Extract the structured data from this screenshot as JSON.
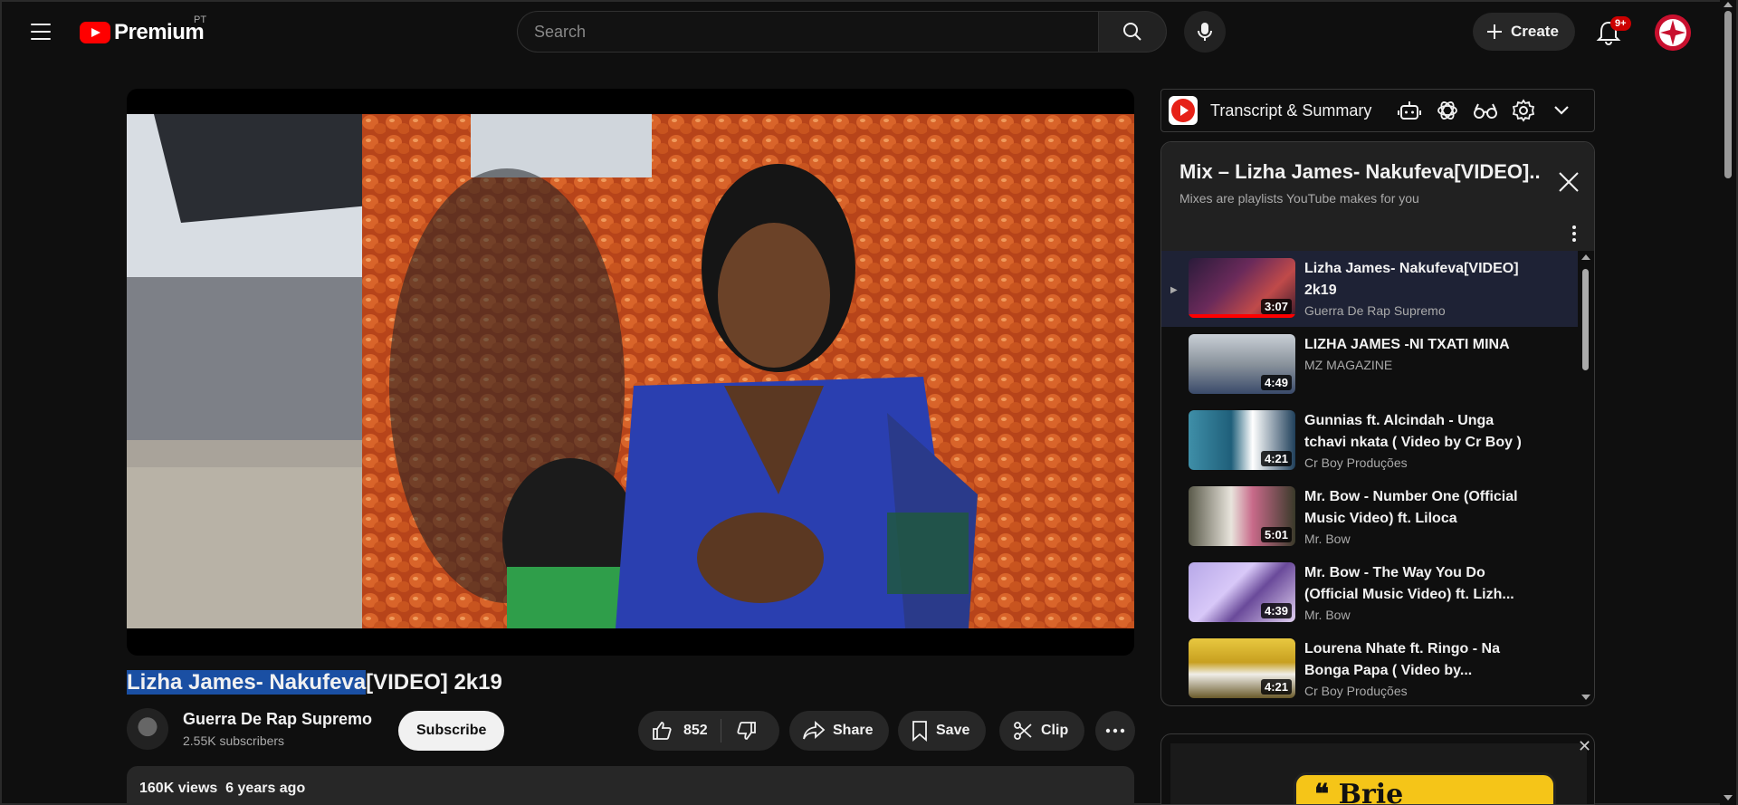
{
  "header": {
    "logo_text": "Premium",
    "country_code": "PT",
    "search_placeholder": "Search",
    "create_label": "Create",
    "notification_count": "9+"
  },
  "video": {
    "title_highlighted": "Lizha James- Nakufeva",
    "title_rest": "[VIDEO] 2k19",
    "channel_name": "Guerra De Rap Supremo",
    "subscribers": "2.55K subscribers",
    "subscribe_label": "Subscribe",
    "likes": "852",
    "share_label": "Share",
    "save_label": "Save",
    "clip_label": "Clip",
    "views": "160K views",
    "age": "6 years ago"
  },
  "extension": {
    "title": "Transcript & Summary",
    "icons": [
      "robot-icon",
      "chatgpt-icon",
      "glasses-icon",
      "gear-icon",
      "chevron-down-icon"
    ]
  },
  "playlist": {
    "title": "Mix – Lizha James- Nakufeva[VIDEO]...",
    "subtitle": "Mixes are playlists YouTube makes for you",
    "items": [
      {
        "title": "Lizha James- Nakufeva[VIDEO] 2k19",
        "channel": "Guerra De Rap Supremo",
        "duration": "3:07",
        "active": true
      },
      {
        "title": "LIZHA JAMES -NI TXATI MINA",
        "channel": "MZ MAGAZINE",
        "duration": "4:49",
        "active": false
      },
      {
        "title": "Gunnias ft. Alcindah - Unga tchavi nkata ( Video by Cr Boy )",
        "channel": "Cr Boy Produções",
        "duration": "4:21",
        "active": false
      },
      {
        "title": "Mr. Bow - Number One (Official Music Video) ft. Liloca",
        "channel": "Mr. Bow",
        "duration": "5:01",
        "active": false
      },
      {
        "title": "Mr. Bow - The Way You Do (Official Music Video) ft. Lizh...",
        "channel": "Mr. Bow",
        "duration": "4:39",
        "active": false
      },
      {
        "title": "Lourena Nhate ft. Ringo - Na Bonga Papa ( Video by...",
        "channel": "Cr Boy Produções",
        "duration": "4:21",
        "active": false
      }
    ]
  },
  "ad": {
    "banner_text": "❝ Brie Brilliant!"
  },
  "colors": {
    "background": "#0f0f0f",
    "accent_red": "#ff0000",
    "highlight": "#1a4fa3",
    "active_row": "#1e2235"
  }
}
